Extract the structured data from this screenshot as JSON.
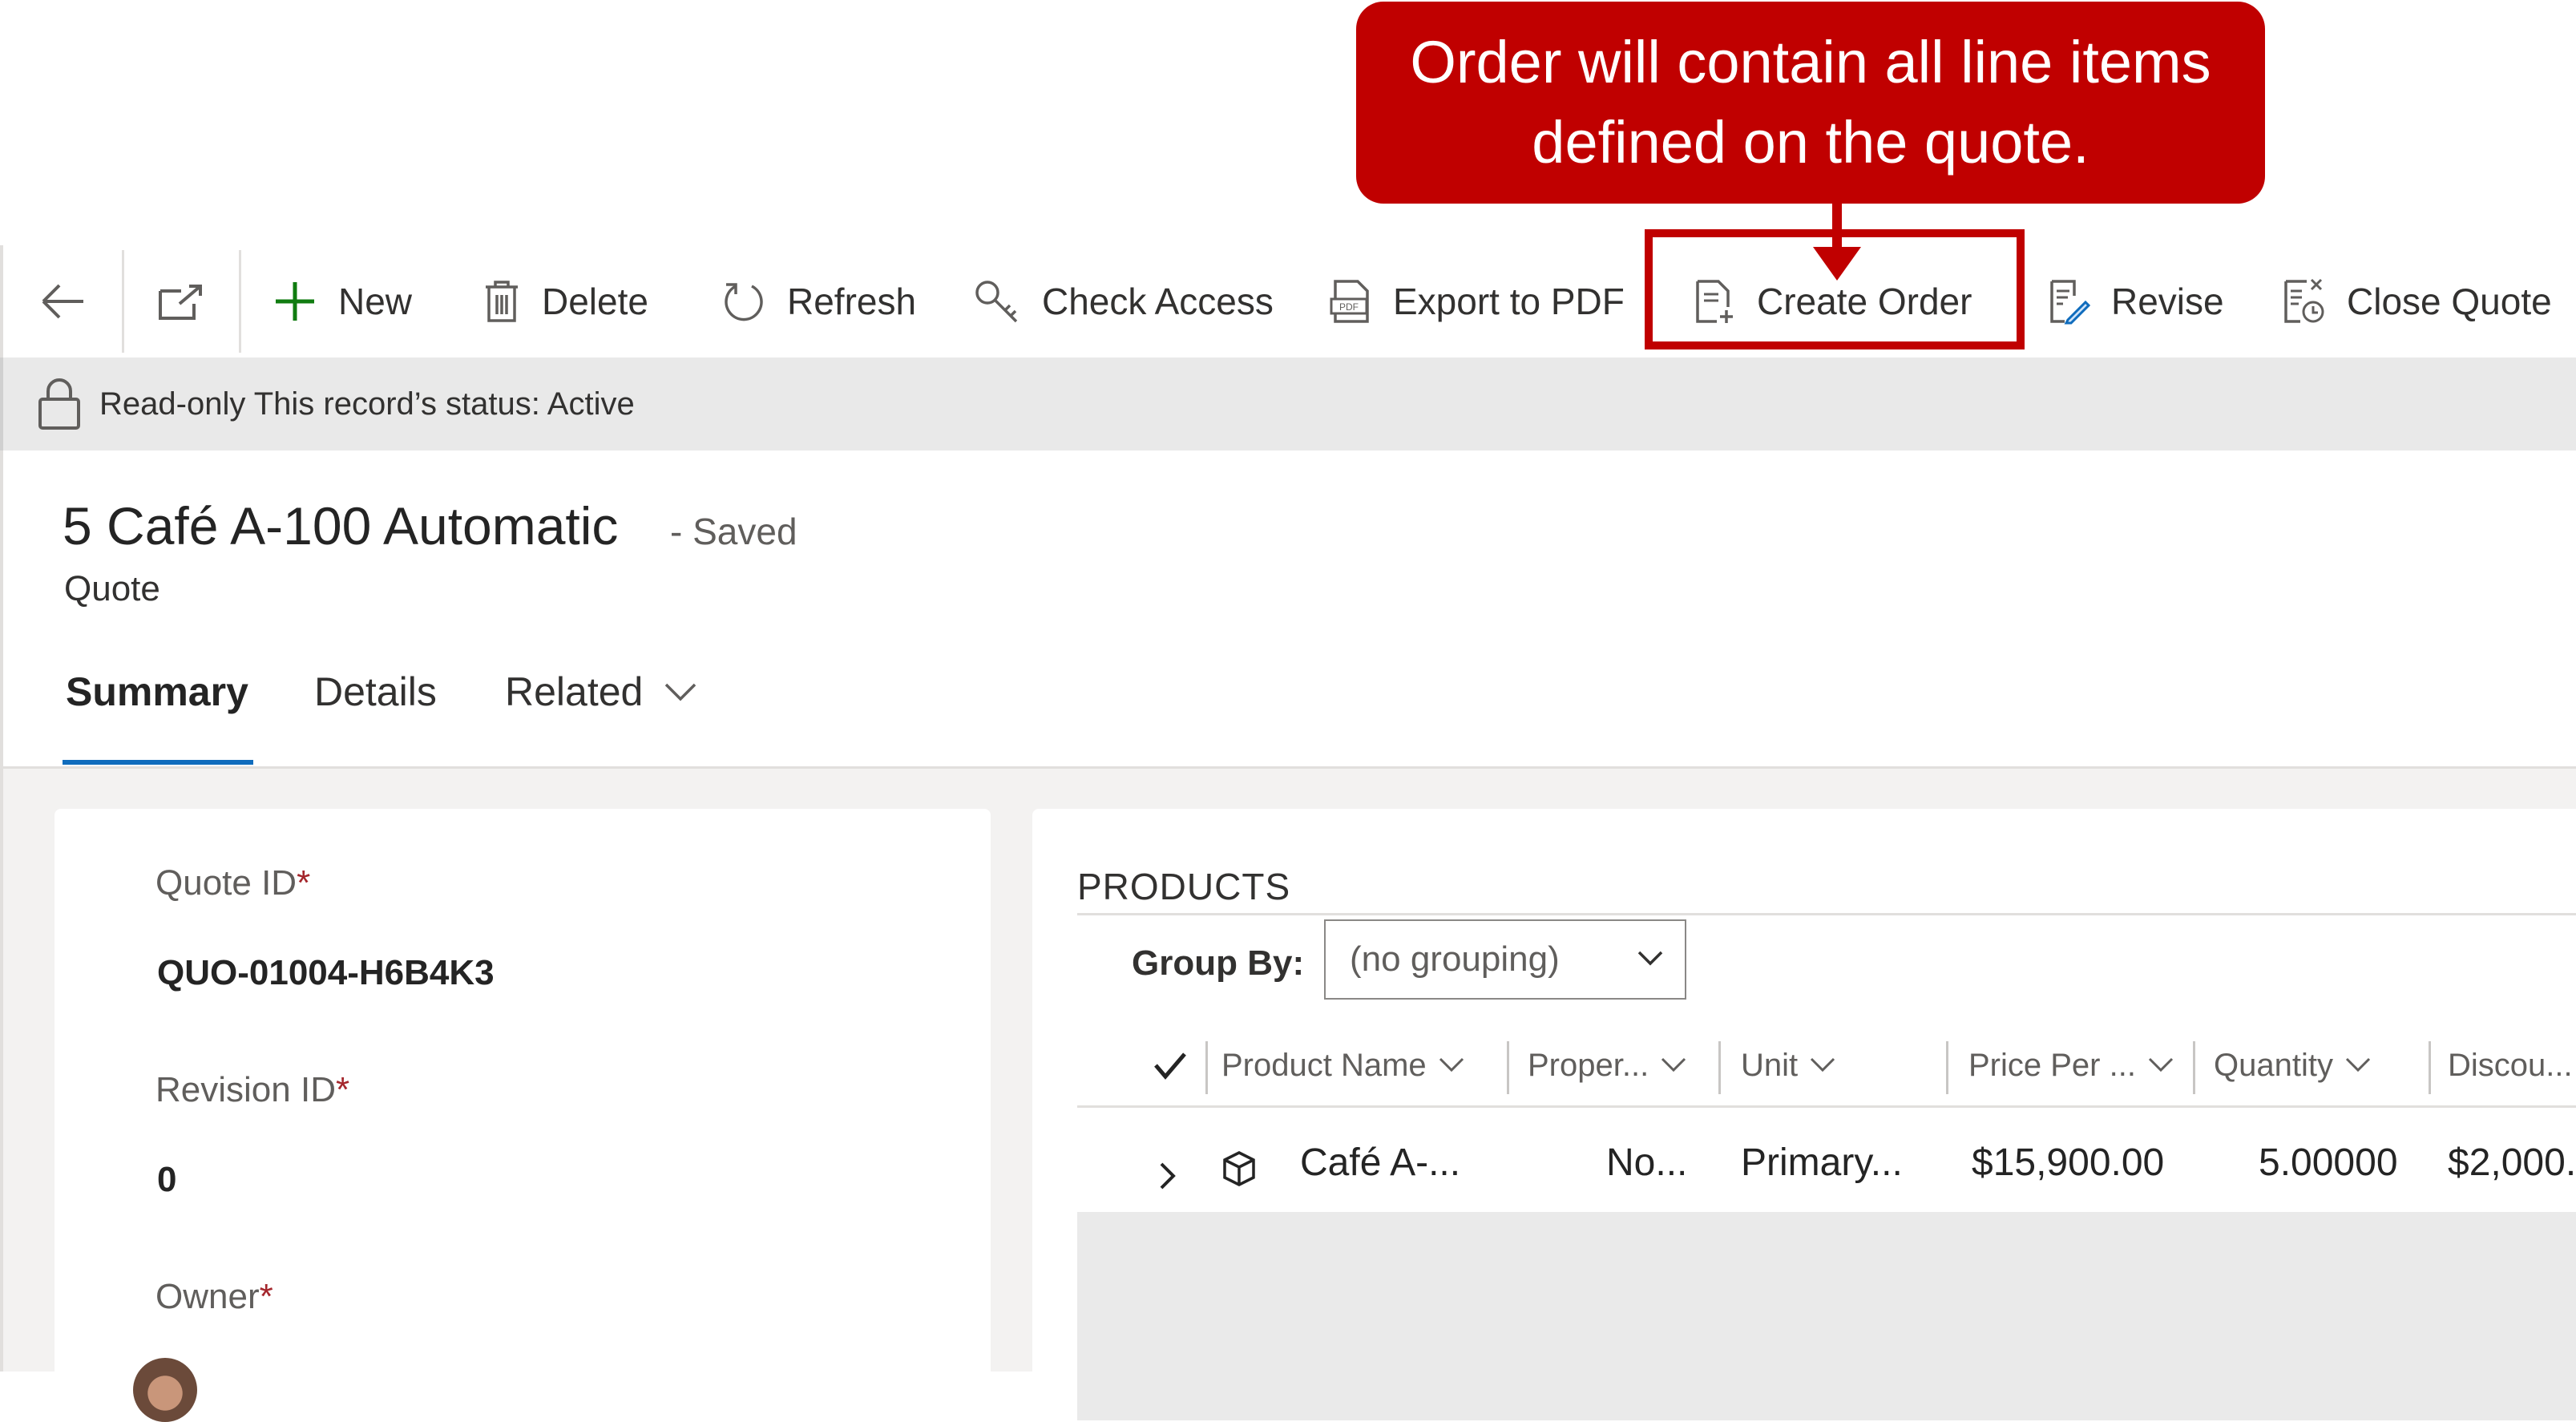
{
  "callout": {
    "line1": "Order will contain all line items",
    "line2": "defined on the quote."
  },
  "command_bar": {
    "back_icon": "arrow-left-icon",
    "popout_icon": "popout-icon",
    "new_label": "New",
    "delete_label": "Delete",
    "refresh_label": "Refresh",
    "check_access_label": "Check Access",
    "export_pdf_label": "Export to PDF",
    "create_order_label": "Create Order",
    "revise_label": "Revise",
    "close_quote_label": "Close Quote"
  },
  "readonly_bar": {
    "text": "Read-only This record’s status: Active"
  },
  "header": {
    "title": "5 Café A-100 Automatic",
    "save_status": "- Saved",
    "entity": "Quote"
  },
  "tabs": {
    "summary": "Summary",
    "details": "Details",
    "related": "Related"
  },
  "form": {
    "quote_id_label": "Quote ID",
    "quote_id_value": "QUO-01004-H6B4K3",
    "revision_id_label": "Revision ID",
    "revision_id_value": "0",
    "owner_label": "Owner",
    "required_mark": "*"
  },
  "products": {
    "title": "PRODUCTS",
    "group_by_label": "Group By:",
    "group_by_value": "(no grouping)",
    "columns": [
      "Product Name",
      "Proper...",
      "Unit",
      "Price Per ...",
      "Quantity",
      "Discou..."
    ],
    "row": [
      "Café A-...",
      "No...",
      "Primary...",
      "$15,900.00",
      "5.00000",
      "$2,000."
    ]
  },
  "colors": {
    "callout": "#c00000",
    "accent": "#0f6cbd",
    "new_icon": "#107c10"
  }
}
